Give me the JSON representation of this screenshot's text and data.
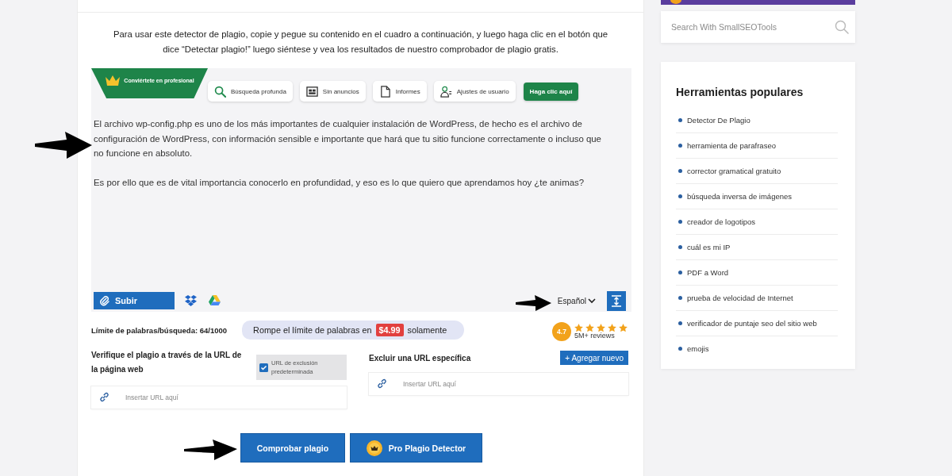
{
  "intro": {
    "text": "Para usar este detector de plagio, copie y pegue su contenido en el cuadro a continuación, y luego haga clic en el botón que dice “Detectar plagio!” luego siéntese y vea los resultados de nuestro comprobador de plagio gratis."
  },
  "toolbar": {
    "promo": "Conviértete en profesional",
    "features": [
      {
        "kind": "search",
        "label": "Búsqueda profunda"
      },
      {
        "kind": "no_ads",
        "label": "Sin anuncios"
      },
      {
        "kind": "reports",
        "label": "Informes"
      },
      {
        "kind": "users",
        "label": "Ajustes de usuario"
      }
    ],
    "cta": "Haga clic aquí"
  },
  "editor": {
    "text": "El archivo wp-config.php es uno de los más importantes de cualquier instalación de WordPress, de hecho es el archivo de configuración de WordPress, con información sensible e importante que hará que tu sitio funcione correctamente o incluso que no funcione en absoluto.\n\nEs por ello que es de vital importancia conocerlo en profundidad, y eso es lo que quiero que aprendamos hoy ¿te animas?"
  },
  "editor_bar": {
    "upload": "Subir",
    "language": "Español"
  },
  "limits": {
    "label": "Límite de palabras/búsqueda: 64/1000",
    "offer": "Rompe el límite de palabras en",
    "price": "$4.99",
    "offer_end": "solamente"
  },
  "rating": {
    "score": "4.7",
    "stars": 5,
    "reviews": "5M+ reviews"
  },
  "url_check": {
    "title": "Verifique el plagio a través de la URL de la página web",
    "exclusion": {
      "label": "URL de exclusión predeterminada",
      "checked": true
    },
    "placeholder": "Insertar URL aquí"
  },
  "exclude_url": {
    "title": "Excluir una URL específica",
    "button": "+ Agregar nuevo",
    "placeholder": "Insertar URL aquí"
  },
  "actions": [
    {
      "kind": "check",
      "label": "Comprobar plagio"
    },
    {
      "kind": "pro",
      "label": "Pro Plagio Detector"
    }
  ],
  "sidebar": {
    "search": {
      "placeholder": "Search With SmallSEOTools"
    },
    "popular": {
      "title": "Herramientas populares",
      "items": [
        "Detector De Plagio",
        "herramienta de parafraseo",
        "corrector gramatical gratuito",
        "búsqueda inversa de imágenes",
        "creador de logotipos",
        "cuál es mi IP",
        "PDF a Word",
        "prueba de velocidad de Internet",
        "verificador de puntaje seo del sitio web",
        "emojis"
      ]
    }
  }
}
